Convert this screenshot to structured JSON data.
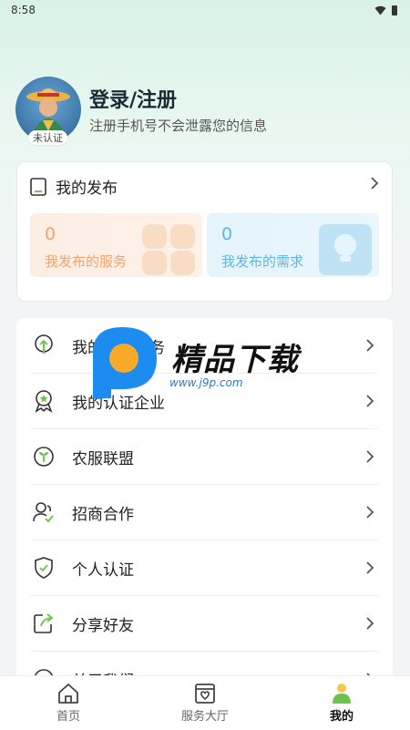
{
  "status_bar": {
    "time": "8:58"
  },
  "profile": {
    "badge": "未认证",
    "title": "登录/注册",
    "subtitle": "注册手机号不会泄露您的信息"
  },
  "publish": {
    "title": "我的发布",
    "service": {
      "count": "0",
      "label": "我发布的服务"
    },
    "need": {
      "count": "0",
      "label": "我发布的需求"
    }
  },
  "menu": [
    {
      "label": "我的金融服务",
      "icon": "tree-icon"
    },
    {
      "label": "我的认证企业",
      "icon": "award-icon"
    },
    {
      "label": "农服联盟",
      "icon": "sprout-icon"
    },
    {
      "label": "招商合作",
      "icon": "people-icon"
    },
    {
      "label": "个人认证",
      "icon": "shield-check-icon"
    },
    {
      "label": "分享好友",
      "icon": "share-icon"
    },
    {
      "label": "关于我们",
      "icon": "info-icon"
    }
  ],
  "watermark": {
    "text": "精品下载",
    "url": "www.j9p.com"
  },
  "tabs": [
    {
      "label": "首页",
      "icon": "home-icon"
    },
    {
      "label": "服务大厅",
      "icon": "service-hall-icon"
    },
    {
      "label": "我的",
      "icon": "user-icon"
    }
  ],
  "colors": {
    "accent": "#6cc24a",
    "service_tile": "#eea46a",
    "need_tile": "#5fb6e0"
  }
}
